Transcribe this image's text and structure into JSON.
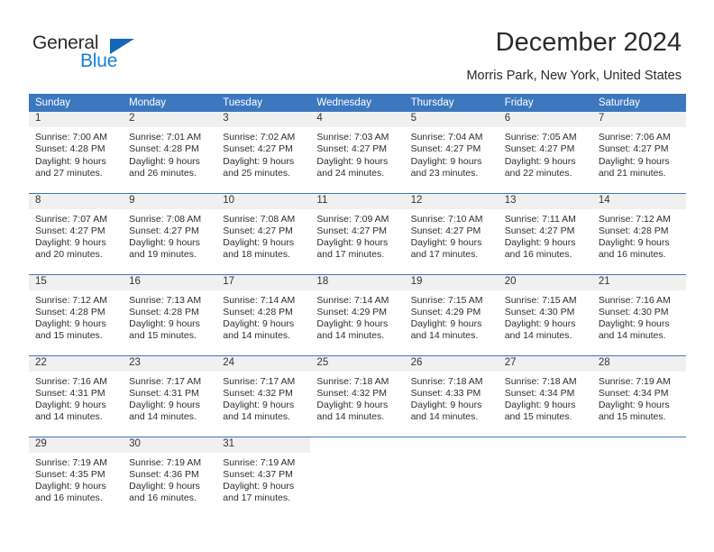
{
  "logo": {
    "word1": "General",
    "word2": "Blue",
    "accent_color": "#1b7fd4",
    "triangle_color": "#1668b5",
    "icon": "general-blue-logo"
  },
  "header": {
    "title": "December 2024",
    "subtitle": "Morris Park, New York, United States"
  },
  "calendar": {
    "header_color": "#3d78bf",
    "daynum_bg": "#f0f0f0",
    "weekdays": [
      "Sunday",
      "Monday",
      "Tuesday",
      "Wednesday",
      "Thursday",
      "Friday",
      "Saturday"
    ],
    "weeks": [
      [
        {
          "day": "1",
          "sunrise": "Sunrise: 7:00 AM",
          "sunset": "Sunset: 4:28 PM",
          "daylight1": "Daylight: 9 hours",
          "daylight2": "and 27 minutes."
        },
        {
          "day": "2",
          "sunrise": "Sunrise: 7:01 AM",
          "sunset": "Sunset: 4:28 PM",
          "daylight1": "Daylight: 9 hours",
          "daylight2": "and 26 minutes."
        },
        {
          "day": "3",
          "sunrise": "Sunrise: 7:02 AM",
          "sunset": "Sunset: 4:27 PM",
          "daylight1": "Daylight: 9 hours",
          "daylight2": "and 25 minutes."
        },
        {
          "day": "4",
          "sunrise": "Sunrise: 7:03 AM",
          "sunset": "Sunset: 4:27 PM",
          "daylight1": "Daylight: 9 hours",
          "daylight2": "and 24 minutes."
        },
        {
          "day": "5",
          "sunrise": "Sunrise: 7:04 AM",
          "sunset": "Sunset: 4:27 PM",
          "daylight1": "Daylight: 9 hours",
          "daylight2": "and 23 minutes."
        },
        {
          "day": "6",
          "sunrise": "Sunrise: 7:05 AM",
          "sunset": "Sunset: 4:27 PM",
          "daylight1": "Daylight: 9 hours",
          "daylight2": "and 22 minutes."
        },
        {
          "day": "7",
          "sunrise": "Sunrise: 7:06 AM",
          "sunset": "Sunset: 4:27 PM",
          "daylight1": "Daylight: 9 hours",
          "daylight2": "and 21 minutes."
        }
      ],
      [
        {
          "day": "8",
          "sunrise": "Sunrise: 7:07 AM",
          "sunset": "Sunset: 4:27 PM",
          "daylight1": "Daylight: 9 hours",
          "daylight2": "and 20 minutes."
        },
        {
          "day": "9",
          "sunrise": "Sunrise: 7:08 AM",
          "sunset": "Sunset: 4:27 PM",
          "daylight1": "Daylight: 9 hours",
          "daylight2": "and 19 minutes."
        },
        {
          "day": "10",
          "sunrise": "Sunrise: 7:08 AM",
          "sunset": "Sunset: 4:27 PM",
          "daylight1": "Daylight: 9 hours",
          "daylight2": "and 18 minutes."
        },
        {
          "day": "11",
          "sunrise": "Sunrise: 7:09 AM",
          "sunset": "Sunset: 4:27 PM",
          "daylight1": "Daylight: 9 hours",
          "daylight2": "and 17 minutes."
        },
        {
          "day": "12",
          "sunrise": "Sunrise: 7:10 AM",
          "sunset": "Sunset: 4:27 PM",
          "daylight1": "Daylight: 9 hours",
          "daylight2": "and 17 minutes."
        },
        {
          "day": "13",
          "sunrise": "Sunrise: 7:11 AM",
          "sunset": "Sunset: 4:27 PM",
          "daylight1": "Daylight: 9 hours",
          "daylight2": "and 16 minutes."
        },
        {
          "day": "14",
          "sunrise": "Sunrise: 7:12 AM",
          "sunset": "Sunset: 4:28 PM",
          "daylight1": "Daylight: 9 hours",
          "daylight2": "and 16 minutes."
        }
      ],
      [
        {
          "day": "15",
          "sunrise": "Sunrise: 7:12 AM",
          "sunset": "Sunset: 4:28 PM",
          "daylight1": "Daylight: 9 hours",
          "daylight2": "and 15 minutes."
        },
        {
          "day": "16",
          "sunrise": "Sunrise: 7:13 AM",
          "sunset": "Sunset: 4:28 PM",
          "daylight1": "Daylight: 9 hours",
          "daylight2": "and 15 minutes."
        },
        {
          "day": "17",
          "sunrise": "Sunrise: 7:14 AM",
          "sunset": "Sunset: 4:28 PM",
          "daylight1": "Daylight: 9 hours",
          "daylight2": "and 14 minutes."
        },
        {
          "day": "18",
          "sunrise": "Sunrise: 7:14 AM",
          "sunset": "Sunset: 4:29 PM",
          "daylight1": "Daylight: 9 hours",
          "daylight2": "and 14 minutes."
        },
        {
          "day": "19",
          "sunrise": "Sunrise: 7:15 AM",
          "sunset": "Sunset: 4:29 PM",
          "daylight1": "Daylight: 9 hours",
          "daylight2": "and 14 minutes."
        },
        {
          "day": "20",
          "sunrise": "Sunrise: 7:15 AM",
          "sunset": "Sunset: 4:30 PM",
          "daylight1": "Daylight: 9 hours",
          "daylight2": "and 14 minutes."
        },
        {
          "day": "21",
          "sunrise": "Sunrise: 7:16 AM",
          "sunset": "Sunset: 4:30 PM",
          "daylight1": "Daylight: 9 hours",
          "daylight2": "and 14 minutes."
        }
      ],
      [
        {
          "day": "22",
          "sunrise": "Sunrise: 7:16 AM",
          "sunset": "Sunset: 4:31 PM",
          "daylight1": "Daylight: 9 hours",
          "daylight2": "and 14 minutes."
        },
        {
          "day": "23",
          "sunrise": "Sunrise: 7:17 AM",
          "sunset": "Sunset: 4:31 PM",
          "daylight1": "Daylight: 9 hours",
          "daylight2": "and 14 minutes."
        },
        {
          "day": "24",
          "sunrise": "Sunrise: 7:17 AM",
          "sunset": "Sunset: 4:32 PM",
          "daylight1": "Daylight: 9 hours",
          "daylight2": "and 14 minutes."
        },
        {
          "day": "25",
          "sunrise": "Sunrise: 7:18 AM",
          "sunset": "Sunset: 4:32 PM",
          "daylight1": "Daylight: 9 hours",
          "daylight2": "and 14 minutes."
        },
        {
          "day": "26",
          "sunrise": "Sunrise: 7:18 AM",
          "sunset": "Sunset: 4:33 PM",
          "daylight1": "Daylight: 9 hours",
          "daylight2": "and 14 minutes."
        },
        {
          "day": "27",
          "sunrise": "Sunrise: 7:18 AM",
          "sunset": "Sunset: 4:34 PM",
          "daylight1": "Daylight: 9 hours",
          "daylight2": "and 15 minutes."
        },
        {
          "day": "28",
          "sunrise": "Sunrise: 7:19 AM",
          "sunset": "Sunset: 4:34 PM",
          "daylight1": "Daylight: 9 hours",
          "daylight2": "and 15 minutes."
        }
      ],
      [
        {
          "day": "29",
          "sunrise": "Sunrise: 7:19 AM",
          "sunset": "Sunset: 4:35 PM",
          "daylight1": "Daylight: 9 hours",
          "daylight2": "and 16 minutes."
        },
        {
          "day": "30",
          "sunrise": "Sunrise: 7:19 AM",
          "sunset": "Sunset: 4:36 PM",
          "daylight1": "Daylight: 9 hours",
          "daylight2": "and 16 minutes."
        },
        {
          "day": "31",
          "sunrise": "Sunrise: 7:19 AM",
          "sunset": "Sunset: 4:37 PM",
          "daylight1": "Daylight: 9 hours",
          "daylight2": "and 17 minutes."
        },
        {
          "day": "",
          "sunrise": "",
          "sunset": "",
          "daylight1": "",
          "daylight2": ""
        },
        {
          "day": "",
          "sunrise": "",
          "sunset": "",
          "daylight1": "",
          "daylight2": ""
        },
        {
          "day": "",
          "sunrise": "",
          "sunset": "",
          "daylight1": "",
          "daylight2": ""
        },
        {
          "day": "",
          "sunrise": "",
          "sunset": "",
          "daylight1": "",
          "daylight2": ""
        }
      ]
    ]
  }
}
